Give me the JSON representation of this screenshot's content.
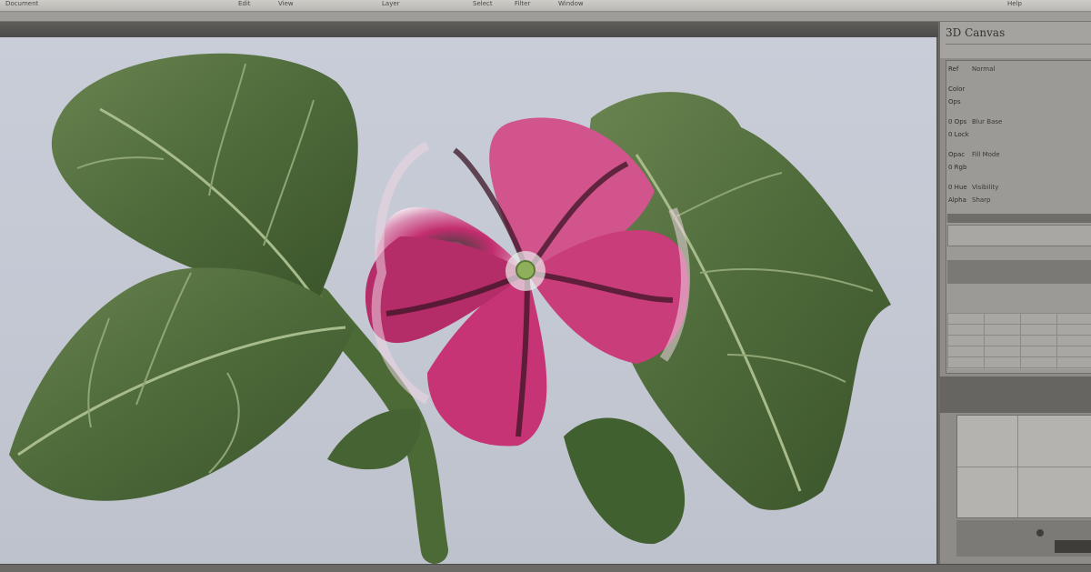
{
  "menubar": {
    "items": [
      "Document",
      "Edit",
      "View",
      "Layer",
      "Select",
      "Filter",
      "Window",
      "Help"
    ]
  },
  "panel": {
    "title": "3D Canvas",
    "rows": [
      {
        "a": "Ref",
        "b": "Normal"
      },
      {
        "a": "Color",
        "b": ""
      },
      {
        "a": "Ops",
        "b": ""
      },
      {
        "a": "0 Ops",
        "b": "Blur Base"
      },
      {
        "a": "0 Lock",
        "b": ""
      },
      {
        "a": "Opac",
        "b": "Fill Mode"
      },
      {
        "a": "0 Rgb",
        "b": ""
      },
      {
        "a": "0 Hue",
        "b": "Visibility"
      },
      {
        "a": "Alpha",
        "b": "Sharp"
      }
    ]
  },
  "colors": {
    "canvas_bg": "#c7cbd6",
    "leaf": "#4f6a3b",
    "petal": "#c0306f",
    "petal_light": "#e7c3d6"
  }
}
